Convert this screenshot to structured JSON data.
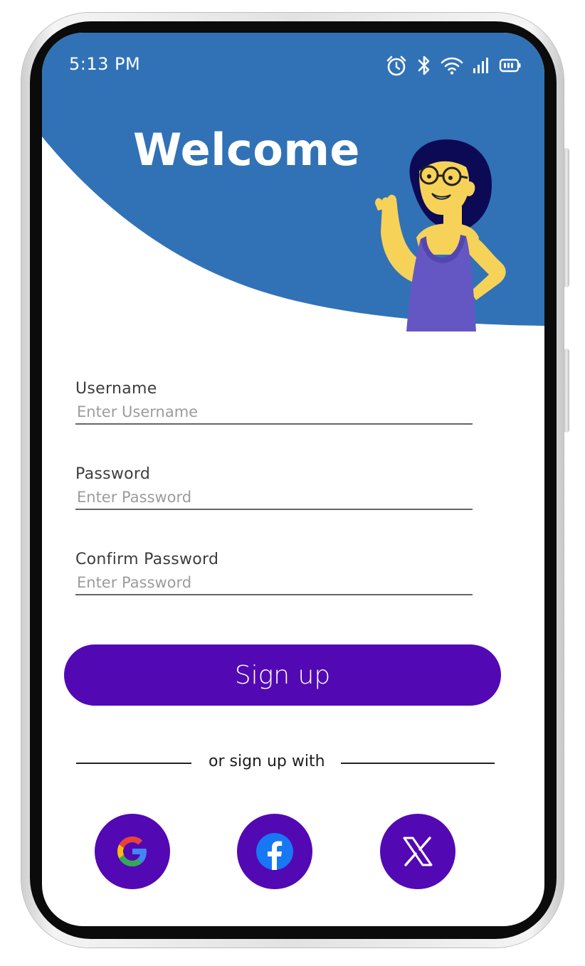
{
  "status_bar": {
    "time": "5:13 PM",
    "icons": [
      "alarm-icon",
      "bluetooth-icon",
      "wifi-icon",
      "signal-icon",
      "battery-icon"
    ]
  },
  "header": {
    "title": "Welcome",
    "illustration": "waving-woman-illustration"
  },
  "form": {
    "username": {
      "label": "Username",
      "placeholder": "Enter Username"
    },
    "password": {
      "label": "Password",
      "placeholder": "Enter Password"
    },
    "confirm_password": {
      "label": "Confirm Password",
      "placeholder": "Enter Password"
    }
  },
  "signup_button": {
    "label": "Sign up"
  },
  "social": {
    "divider_text": "or sign up with",
    "providers": [
      "google-icon",
      "facebook-icon",
      "x-icon"
    ]
  },
  "colors": {
    "header_blue": "#3172b6",
    "primary_purple": "#5209b4",
    "label_text": "#3d3d3d",
    "placeholder_text": "#9c9c9c"
  }
}
